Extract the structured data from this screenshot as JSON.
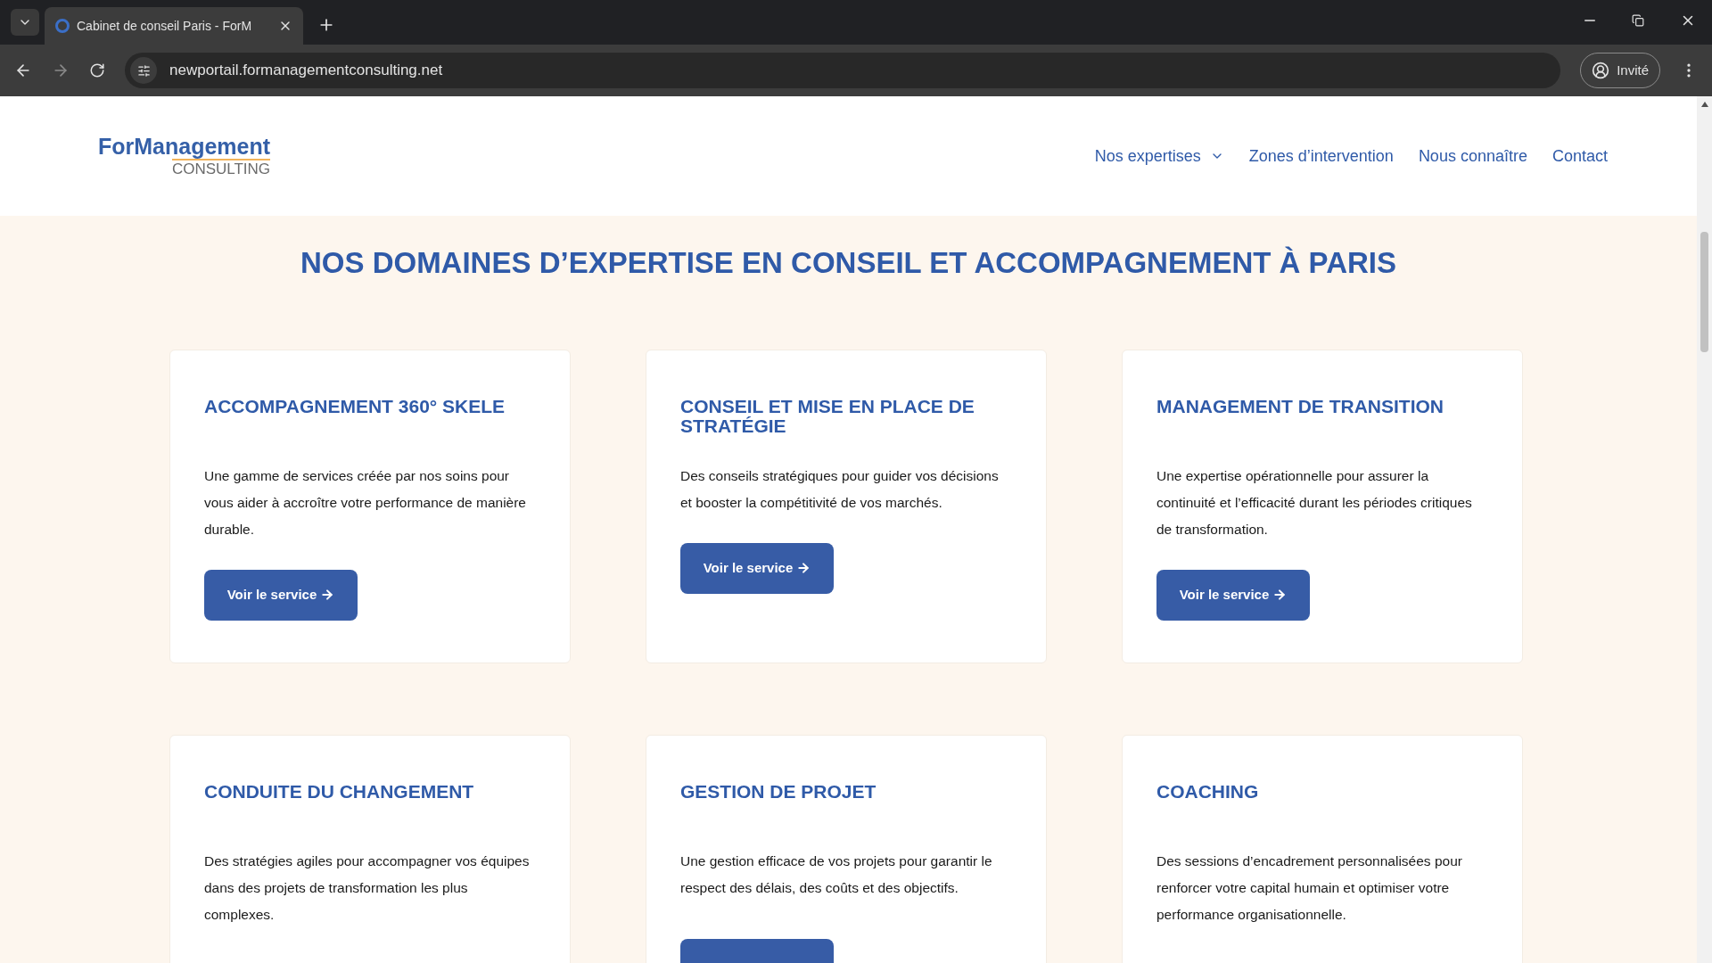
{
  "browser": {
    "tab_title": "Cabinet de conseil Paris - ForM",
    "url": "newportail.formanagementconsulting.net",
    "profile": "Invité"
  },
  "site": {
    "logo": {
      "line1": "ForManagement",
      "line2": "CONSULTING"
    },
    "nav": [
      {
        "label": "Nos expertises",
        "dropdown": true
      },
      {
        "label": "Zones d’intervention",
        "dropdown": false
      },
      {
        "label": "Nous connaître",
        "dropdown": false
      },
      {
        "label": "Contact",
        "dropdown": false
      }
    ]
  },
  "heading": "NOS DOMAINES D’EXPERTISE EN CONSEIL ET ACCOMPAGNEMENT À PARIS",
  "cards": [
    {
      "title": "ACCOMPAGNEMENT 360° SKELE",
      "text": "Une gamme de services créée par nos soins pour vous aider à accroître votre performance de manière durable.",
      "button": "Voir le service"
    },
    {
      "title": "CONSEIL ET MISE EN PLACE DE STRATÉGIE",
      "text": "Des conseils stratégiques pour guider vos décisions et booster la compétitivité de vos marchés.",
      "button": "Voir le service"
    },
    {
      "title": "MANAGEMENT DE TRANSITION",
      "text": "Une expertise opérationnelle pour assurer la continuité et l’efficacité durant les périodes critiques de transformation.",
      "button": "Voir le service"
    },
    {
      "title": "CONDUITE DU CHANGEMENT",
      "text": "Des stratégies agiles pour accompagner vos équipes dans des projets de transformation les plus complexes."
    },
    {
      "title": "GESTION DE PROJET",
      "text": "Une gestion efficace de vos projets pour garantir le respect des délais, des coûts et des objectifs."
    },
    {
      "title": "COACHING",
      "text": "Des sessions d’encadrement personnalisées pour renforcer votre capital humain et optimiser votre performance organisationnelle."
    }
  ]
}
